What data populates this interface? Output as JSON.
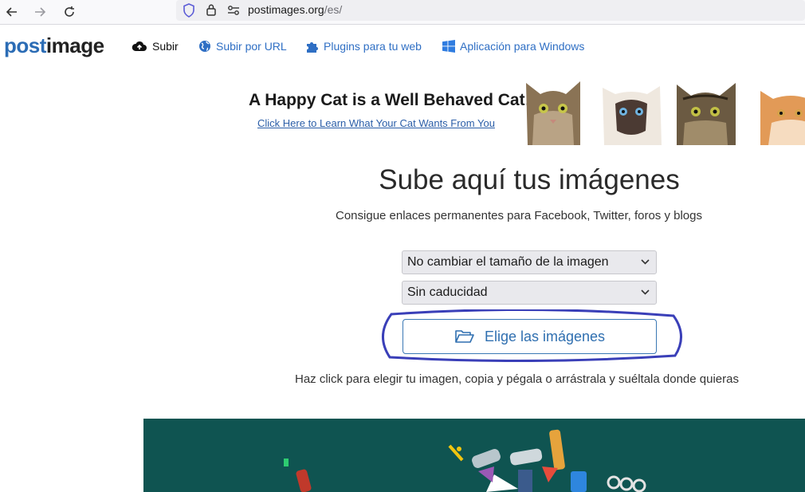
{
  "browser": {
    "url_host": "postimages.org",
    "url_path": "/es/"
  },
  "site": {
    "logo_part1": "post",
    "logo_part2": "image",
    "nav": [
      {
        "label": "Subir",
        "icon": "cloud-upload-icon"
      },
      {
        "label": "Subir por URL",
        "icon": "globe-icon"
      },
      {
        "label": "Plugins para tu web",
        "icon": "puzzle-icon"
      },
      {
        "label": "Aplicación para Windows",
        "icon": "windows-icon"
      }
    ]
  },
  "ad": {
    "title": "A Happy Cat is a Well Behaved Cat!",
    "link": "Click Here to Learn What Your Cat Wants From You"
  },
  "main": {
    "heading": "Sube aquí tus imágenes",
    "subtitle": "Consigue enlaces permanentes para Facebook, Twitter, foros y blogs",
    "resize_select": "No cambiar el tamaño de la imagen",
    "expiry_select": "Sin caducidad",
    "choose_button": "Elige las imágenes",
    "hint": "Haz click para elegir tu imagen, copia y pégala o arrástrala y suéltala donde quieras"
  },
  "colors": {
    "link": "#2f6fc4",
    "button_border": "#3a78b4",
    "highlight_circle": "#3a3fb8",
    "promo_bg": "#0f5451"
  }
}
